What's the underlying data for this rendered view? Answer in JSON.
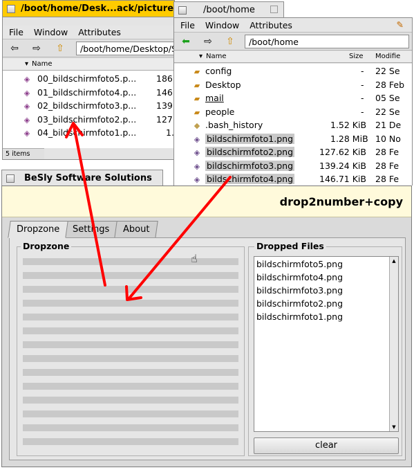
{
  "win_left": {
    "title": "/boot/home/Desk...ack/picture",
    "menu": [
      "File",
      "Window",
      "Attributes"
    ],
    "path": "/boot/home/Desktop/S",
    "col_name": "Name",
    "files": [
      {
        "name": "00_bildschirmfoto5.p...",
        "size": "186"
      },
      {
        "name": "01_bildschirmfoto4.p...",
        "size": "146"
      },
      {
        "name": "02_bildschirmfoto3.p...",
        "size": "139"
      },
      {
        "name": "03_bildschirmfoto2.p...",
        "size": "127"
      },
      {
        "name": "04_bildschirmfoto1.p...",
        "size": "1."
      }
    ],
    "status": "5 items"
  },
  "win_right": {
    "title": "/boot/home",
    "menu": [
      "File",
      "Window",
      "Attributes"
    ],
    "path": "/boot/home",
    "col_name": "Name",
    "col_size": "Size",
    "col_modified": "Modifie",
    "files": [
      {
        "name": "config",
        "size": "-",
        "mod": "22 Se",
        "icon": "folder"
      },
      {
        "name": "Desktop",
        "size": "-",
        "mod": "28 Feb",
        "icon": "folder"
      },
      {
        "name": "mail",
        "size": "-",
        "mod": "05 Se",
        "icon": "folder"
      },
      {
        "name": "people",
        "size": "-",
        "mod": "22 Se",
        "icon": "folder"
      },
      {
        "name": ".bash_history",
        "size": "1.52 KiB",
        "mod": "21 De",
        "icon": "text"
      },
      {
        "name": "bildschirmfoto1.png",
        "size": "1.28 MiB",
        "mod": "10 No",
        "icon": "image"
      },
      {
        "name": "bildschirmfoto2.png",
        "size": "127.62 KiB",
        "mod": "28 Fe",
        "icon": "image"
      },
      {
        "name": "bildschirmfoto3.png",
        "size": "139.24 KiB",
        "mod": "28 Fe",
        "icon": "image"
      },
      {
        "name": "bildschirmfoto4.png",
        "size": "146.71 KiB",
        "mod": "28 Fe",
        "icon": "image"
      }
    ]
  },
  "app": {
    "title": "BeSly Software Solutions",
    "banner": "drop2number+copy",
    "tabs": [
      "Dropzone",
      "Settings",
      "About"
    ],
    "dropzone_label": "Dropzone",
    "dropped_label": "Dropped Files",
    "dropped_files": [
      "bildschirmfoto5.png",
      "bildschirmfoto4.png",
      "bildschirmfoto3.png",
      "bildschirmfoto2.png",
      "bildschirmfoto1.png"
    ],
    "clear_label": "clear"
  },
  "colors": {
    "tab_active": "#ffcb00",
    "tab_inactive": "#e0e0e0",
    "arrow": "#ff0000",
    "banner_bg": "#fffadb"
  }
}
